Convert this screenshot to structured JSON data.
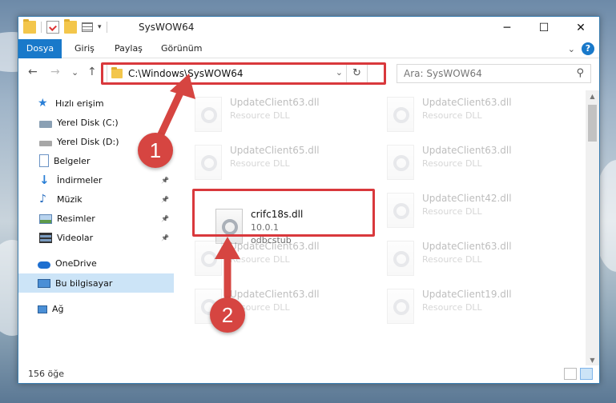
{
  "window": {
    "title": "SysWOW64",
    "minimize_glyph": "─",
    "maximize_glyph": "☐",
    "close_glyph": "✕"
  },
  "ribbon": {
    "tabs": [
      "Dosya",
      "Giriş",
      "Paylaş",
      "Görünüm"
    ],
    "collapse_glyph": "⌄",
    "help_glyph": "?"
  },
  "navigation": {
    "back_glyph": "←",
    "forward_glyph": "→",
    "recent_glyph": "⌄",
    "up_glyph": "↑",
    "address_path": "C:\\Windows\\SysWOW64",
    "address_drop_glyph": "⌄",
    "refresh_glyph": "↻",
    "search_placeholder": "Ara: SysWOW64",
    "search_glyph": "⚲"
  },
  "sidebar": {
    "items": [
      {
        "label": "Hızlı erişim",
        "icon": "star-icon",
        "pinned": false
      },
      {
        "label": "Yerel Disk (C:)",
        "icon": "drive-icon",
        "pinned": false
      },
      {
        "label": "Yerel Disk (D:)",
        "icon": "drive-icon",
        "pinned": false
      },
      {
        "label": "Belgeler",
        "icon": "documents-icon",
        "pinned": true
      },
      {
        "label": "İndirmeler",
        "icon": "downloads-icon",
        "pinned": true
      },
      {
        "label": "Müzik",
        "icon": "music-icon",
        "pinned": true
      },
      {
        "label": "Resimler",
        "icon": "pictures-icon",
        "pinned": true
      },
      {
        "label": "Videolar",
        "icon": "videos-icon",
        "pinned": true
      },
      {
        "label": "OneDrive",
        "icon": "cloud-icon",
        "pinned": false
      },
      {
        "label": "Bu bilgisayar",
        "icon": "computer-icon",
        "pinned": false
      },
      {
        "label": "Ağ",
        "icon": "network-icon",
        "pinned": false
      }
    ],
    "pin_glyph": "📌"
  },
  "files": {
    "highlighted": {
      "name": "crifc18s.dll",
      "line2": "10.0.1",
      "line3": "odbcstub"
    },
    "faded": [
      {
        "name": "UpdateClient63.dll",
        "line2": "Resource DLL"
      },
      {
        "name": "UpdateClient63.dll",
        "line2": "Resource DLL"
      },
      {
        "name": "UpdateClient65.dll",
        "line2": "Resource DLL"
      },
      {
        "name": "UpdateClient63.dll",
        "line2": "Resource DLL"
      },
      {
        "name": "UpdateClient42.dll",
        "line2": "Resource DLL"
      },
      {
        "name": "UpdateClient63.dll",
        "line2": "Resource DLL"
      },
      {
        "name": "UpdateClient63.dll",
        "line2": "Resource DLL"
      },
      {
        "name": "UpdateClient63.dll",
        "line2": "Resource DLL"
      },
      {
        "name": "UpdateClient19.dll",
        "line2": "Resource DLL"
      }
    ]
  },
  "status": {
    "item_count": "156 öğe"
  },
  "annotations": {
    "step1": "1",
    "step2": "2",
    "accent": "#d64541"
  },
  "scrollbar": {
    "up_glyph": "▲",
    "down_glyph": "▼"
  }
}
